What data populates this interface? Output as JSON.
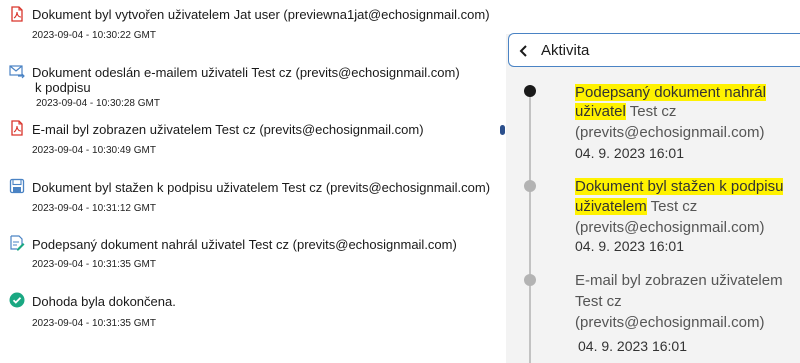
{
  "events": [
    {
      "title": "Dokument byl vytvořen uživatelem Jat user (previewna1jat@echosignmail.com)",
      "time": "2023-09-04 - 10:30:22 GMT",
      "icon": "pdf-document-icon"
    },
    {
      "title": "Dokument odeslán e-mailem uživateli Test cz (previts@echosignmail.com)",
      "continuation": "k podpisu",
      "time": "2023-09-04 - 10:30:28 GMT",
      "icon": "email-send-icon"
    },
    {
      "title": "E-mail byl zobrazen uživatelem Test cz (previts@echosignmail.com)",
      "time": "2023-09-04 - 10:30:49 GMT",
      "icon": "pdf-document-icon"
    },
    {
      "title": "Dokument byl stažen k podpisu uživatelem Test cz (previts@echosignmail.com)",
      "time": "2023-09-04 - 10:31:12 GMT",
      "icon": "save-download-icon"
    },
    {
      "title": "Podepsaný dokument nahrál uživatel Test cz (previts@echosignmail.com)",
      "time": "2023-09-04 - 10:31:35 GMT",
      "icon": "signed-document-icon"
    },
    {
      "title": "Dohoda byla dokončena.",
      "time": "2023-09-04 - 10:31:35 GMT",
      "icon": "check-circle-icon"
    }
  ],
  "panel": {
    "title": "Aktivita",
    "items": [
      {
        "highlight1": "Podepsaný dokument nahrál",
        "highlight2": "uživatel",
        "rest2": " Test cz",
        "line3": "(previts@echosignmail.com)",
        "date": "04. 9. 2023 16:01"
      },
      {
        "highlight1": "Dokument byl stažen k podpisu",
        "highlight2": "uživatelem",
        "rest2": " Test cz",
        "line3": "(previts@echosignmail.com)",
        "date": "04. 9. 2023 16:01"
      },
      {
        "line1": "E-mail byl zobrazen uživatelem",
        "line2": "Test cz",
        "line3": "(previts@echosignmail.com)",
        "date": "04. 9. 2023 16:01"
      }
    ]
  },
  "colors": {
    "highlight": "#fff200",
    "accent": "#4a83c4",
    "pdf": "#d9342b",
    "check": "#1aa882"
  }
}
